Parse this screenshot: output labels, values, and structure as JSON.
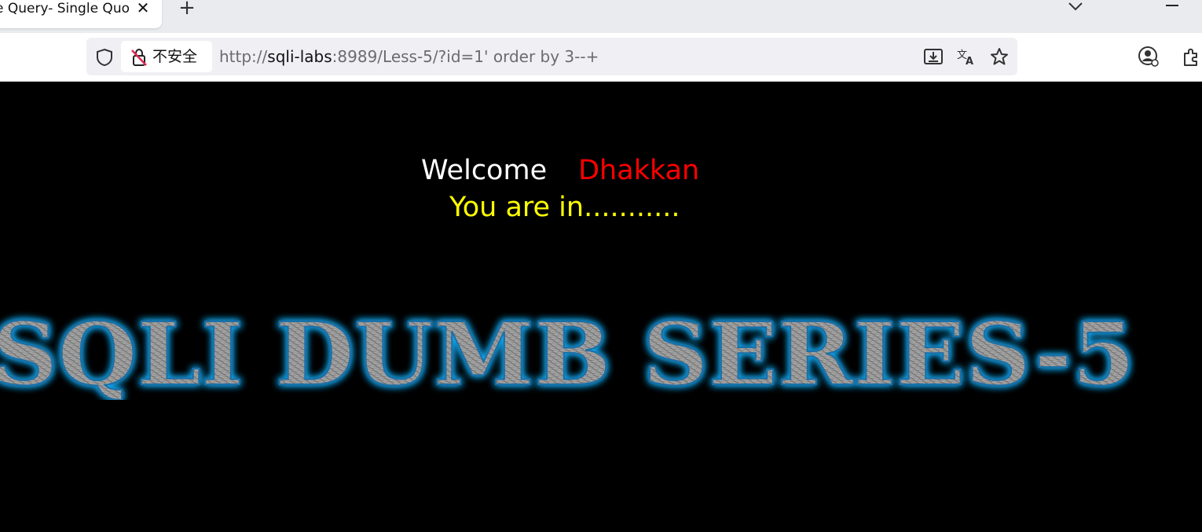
{
  "browser": {
    "tab_title": "e Query- Single Quo",
    "tab_close": "✕",
    "new_tab": "+",
    "security_label": "不安全",
    "url_scheme": "http://",
    "url_host": "sqli-labs",
    "url_rest": ":8989/Less-5/?id=1' order by 3--+"
  },
  "page": {
    "welcome_word": "Welcome",
    "welcome_name": "Dhakkan",
    "status": "You are in...........",
    "banner_text": "SQLI DUMB SERIES-5"
  },
  "colors": {
    "background": "#000000",
    "welcome_word": "#ffffff",
    "welcome_name": "#ff0000",
    "status": "#ffff00",
    "banner_glow": "#16a8f0"
  },
  "icons": [
    "chevron-down-icon",
    "minimize-icon",
    "shield-icon",
    "insecure-lock-icon",
    "download-page-icon",
    "translate-icon",
    "star-icon",
    "account-icon",
    "extensions-icon"
  ]
}
